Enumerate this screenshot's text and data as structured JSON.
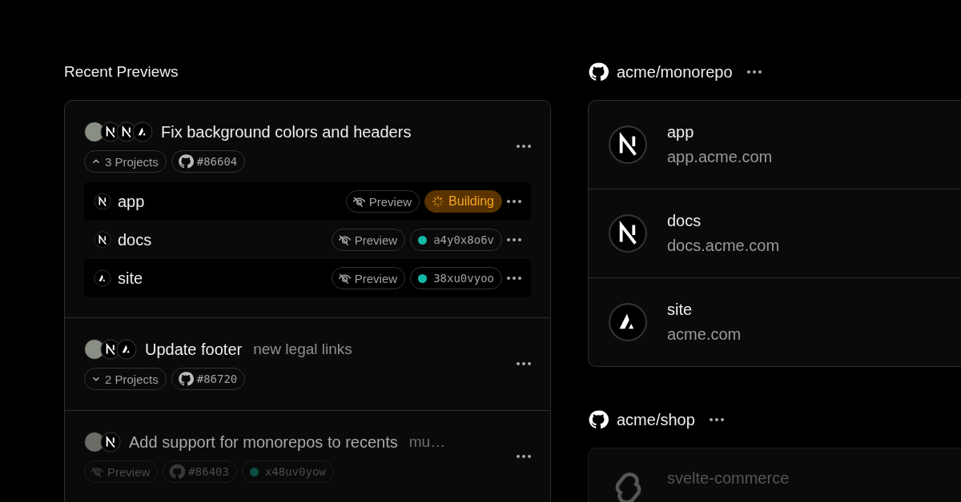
{
  "recent_previews": {
    "title": "Recent Previews",
    "items": [
      {
        "avatars": [
          {
            "kind": "photo"
          },
          {
            "kind": "next"
          },
          {
            "kind": "next"
          },
          {
            "kind": "triangle"
          }
        ],
        "title": "Fix background colors and headers",
        "tags": [
          {
            "kind": "toggle",
            "label": "3 Projects",
            "expanded": true
          },
          {
            "kind": "pr",
            "label": "#86604"
          }
        ],
        "projects": [
          {
            "logo": {
              "kind": "next"
            },
            "name": "app",
            "preview": "Preview",
            "status": {
              "kind": "building",
              "label": "Building"
            }
          },
          {
            "logo": {
              "kind": "next"
            },
            "name": "docs",
            "preview": "Preview",
            "status": {
              "kind": "ready",
              "label": "a4y0x8o6v",
              "color": "#14b8a6"
            }
          },
          {
            "logo": {
              "kind": "triangle"
            },
            "name": "site",
            "preview": "Preview",
            "status": {
              "kind": "ready",
              "label": "38xu0vyoo",
              "color": "#14b8a6"
            }
          }
        ]
      },
      {
        "avatars": [
          {
            "kind": "photo"
          },
          {
            "kind": "next"
          },
          {
            "kind": "triangle"
          }
        ],
        "title": "Update footer",
        "subtitle": "new legal links",
        "tags": [
          {
            "kind": "toggle",
            "label": "2 Projects",
            "expanded": false
          },
          {
            "kind": "pr",
            "label": "#86720"
          }
        ]
      },
      {
        "avatars": [
          {
            "kind": "photo"
          },
          {
            "kind": "next"
          }
        ],
        "title": "Add support for monorepos to recents",
        "subtitle": "mu…",
        "tags": [
          {
            "kind": "preview",
            "label": "Preview"
          },
          {
            "kind": "pr",
            "label": "#86403"
          },
          {
            "kind": "ready",
            "label": "x48uv0yow",
            "color": "#0e4d45"
          }
        ]
      }
    ]
  },
  "repositories": [
    {
      "name": "acme/monorepo",
      "projects": [
        {
          "logo": {
            "kind": "next"
          },
          "name": "app",
          "domain": "app.acme.com"
        },
        {
          "logo": {
            "kind": "next"
          },
          "name": "docs",
          "domain": "docs.acme.com"
        },
        {
          "logo": {
            "kind": "triangle"
          },
          "name": "site",
          "domain": "acme.com"
        }
      ]
    },
    {
      "name": "acme/shop",
      "projects": [
        {
          "logo": {
            "kind": "svelte"
          },
          "name": "svelte-commerce"
        }
      ]
    }
  ]
}
